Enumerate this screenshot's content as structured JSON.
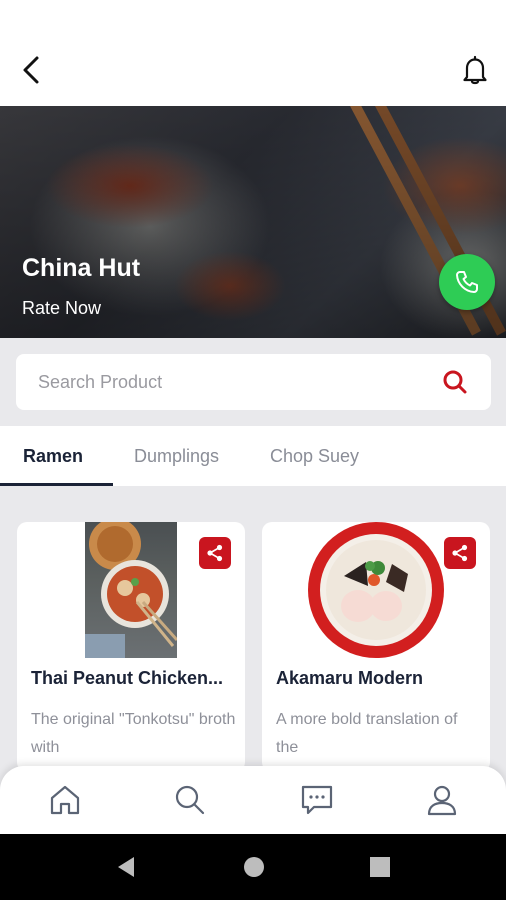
{
  "restaurant": {
    "name": "China Hut",
    "rate_label": "Rate Now"
  },
  "search": {
    "placeholder": "Search Product"
  },
  "tabs": [
    {
      "label": "Ramen",
      "active": true
    },
    {
      "label": "Dumplings",
      "active": false
    },
    {
      "label": "Chop Suey",
      "active": false
    }
  ],
  "products": [
    {
      "name": "Thai Peanut Chicken...",
      "description": "The original \"Tonkotsu\" broth with",
      "image": "noodle-bowl-photo"
    },
    {
      "name": "Akamaru Modern",
      "description": "A more bold translation of the",
      "image": "ramen-bowl-photo"
    }
  ],
  "icons": {
    "back": "chevron-left-icon",
    "notifications": "bell-icon",
    "call": "phone-icon",
    "search": "search-icon",
    "share": "share-icon",
    "nav": [
      "home-icon",
      "search-icon",
      "chat-icon",
      "profile-icon"
    ]
  },
  "colors": {
    "accent_red": "#c9151f",
    "call_green": "#2ecc55",
    "text_dark": "#1b2337",
    "text_muted": "#8e9099",
    "background": "#e9e9ec"
  }
}
